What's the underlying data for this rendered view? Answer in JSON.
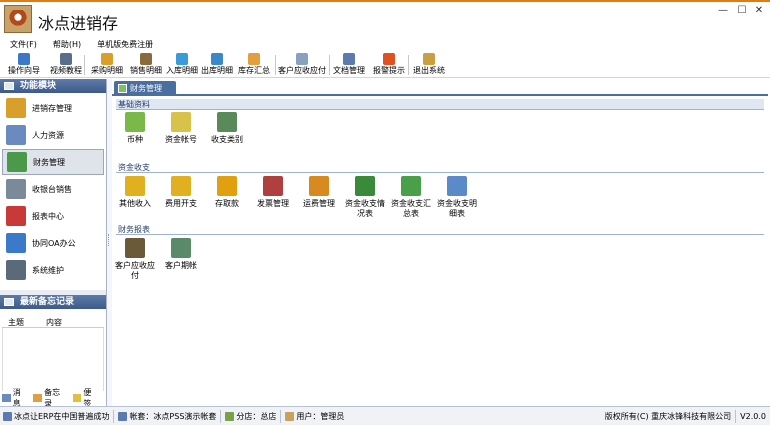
{
  "window": {
    "title": "冰点进销存",
    "min_glyph": "—",
    "max_glyph": "☐",
    "close_glyph": "✕"
  },
  "menu": [
    "文件(F)",
    "帮助(H)",
    "单机版免费注册"
  ],
  "toolbar": [
    {
      "label": "操作向导",
      "icon": "wizard-icon",
      "color": "#3b78c8"
    },
    {
      "label": "视频教程",
      "icon": "video-icon",
      "color": "#5a6e8c"
    },
    {
      "label": "采购明细",
      "icon": "purchase-icon",
      "color": "#d8a02a"
    },
    {
      "label": "销售明细",
      "icon": "sales-icon",
      "color": "#8a6a3a"
    },
    {
      "label": "入库明细",
      "icon": "stock-in-icon",
      "color": "#3b9ad8"
    },
    {
      "label": "出库明细",
      "icon": "stock-out-icon",
      "color": "#3b88c8"
    },
    {
      "label": "库存汇总",
      "icon": "inventory-icon",
      "color": "#e0a040"
    },
    {
      "label": "客户应收应付",
      "icon": "receivable-icon",
      "color": "#8aa0c0"
    },
    {
      "label": "文档管理",
      "icon": "document-icon",
      "color": "#5a7ab0"
    },
    {
      "label": "报警提示",
      "icon": "alarm-icon",
      "color": "#e05020"
    },
    {
      "label": "退出系统",
      "icon": "exit-icon",
      "color": "#c8a040"
    }
  ],
  "left_panel": {
    "title": "功能模块",
    "modules": [
      {
        "label": "进销存管理",
        "icon": "inventory-module-icon",
        "color": "#d8a02a",
        "active": false
      },
      {
        "label": "人力资源",
        "icon": "hr-icon",
        "color": "#6a8ac0",
        "active": false
      },
      {
        "label": "财务管理",
        "icon": "finance-icon",
        "color": "#4a9a4a",
        "active": true
      },
      {
        "label": "收银台销售",
        "icon": "cashier-icon",
        "color": "#7a8a9a",
        "active": false
      },
      {
        "label": "报表中心",
        "icon": "report-icon",
        "color": "#c83a3a",
        "active": false
      },
      {
        "label": "协同OA办公",
        "icon": "oa-icon",
        "color": "#3a7ac8",
        "active": false
      },
      {
        "label": "系统维护",
        "icon": "tools-icon",
        "color": "#5a6a7a",
        "active": false
      }
    ]
  },
  "memo": {
    "title": "最新备忘记录",
    "columns": [
      "主题",
      "内容"
    ],
    "footer": [
      {
        "label": "消息",
        "icon": "message-icon",
        "color": "#6a8ac0"
      },
      {
        "label": "备忘录",
        "icon": "memo-icon",
        "color": "#e0a040"
      },
      {
        "label": "便签",
        "icon": "note-icon",
        "color": "#e0c040"
      }
    ]
  },
  "main": {
    "tab": "财务管理",
    "sections": [
      {
        "title": "基础资料",
        "items": [
          {
            "label": "币种",
            "icon": "yen-icon",
            "color": "#7ab84a"
          },
          {
            "label": "资金帐号",
            "icon": "account-icon",
            "color": "#d8c24a"
          },
          {
            "label": "收支类别",
            "icon": "category-icon",
            "color": "#5a8a5a"
          }
        ]
      },
      {
        "title": "资金收支",
        "items": [
          {
            "label": "其他收入",
            "icon": "income-icon",
            "color": "#e0b020"
          },
          {
            "label": "费用开支",
            "icon": "expense-icon",
            "color": "#e0b020"
          },
          {
            "label": "存取款",
            "icon": "deposit-icon",
            "color": "#e0a010"
          },
          {
            "label": "发票管理",
            "icon": "invoice-icon",
            "color": "#b04040"
          },
          {
            "label": "运费管理",
            "icon": "freight-icon",
            "color": "#d88a20"
          },
          {
            "label": "资金收支情况表",
            "icon": "fund-status-icon",
            "color": "#3a8a3a"
          },
          {
            "label": "资金收支汇总表",
            "icon": "fund-summary-icon",
            "color": "#4aa04a"
          },
          {
            "label": "资金收支明细表",
            "icon": "fund-detail-icon",
            "color": "#5a8ac8"
          }
        ]
      },
      {
        "title": "财务报表",
        "items": [
          {
            "label": "客户应收应付",
            "icon": "customer-receivable-icon",
            "color": "#6a5a3a"
          },
          {
            "label": "客户期帐",
            "icon": "customer-period-icon",
            "color": "#5a8a6a"
          }
        ]
      }
    ]
  },
  "status": [
    {
      "label": "冰点让ERP在中国普遍成功",
      "icon": "info-icon",
      "color": "#5a7ab0"
    },
    {
      "label": "帐套：冰点PSS演示帐套",
      "icon": "ledger-icon",
      "color": "#5a7ab0"
    },
    {
      "label": "分店：总店",
      "icon": "store-icon",
      "color": "#7aa04a"
    },
    {
      "label": "用户：管理员",
      "icon": "user-icon",
      "color": "#c8a060"
    }
  ],
  "status_right": {
    "copyright": "版权所有(C) 重庆冰锋科技有限公司",
    "version": "V2.0.0"
  }
}
